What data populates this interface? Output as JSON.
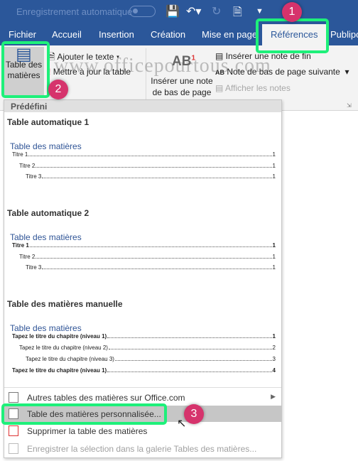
{
  "titlebar": {
    "autosave_label": "Enregistrement automatique"
  },
  "tabs": [
    {
      "label": "Fichier"
    },
    {
      "label": "Accueil"
    },
    {
      "label": "Insertion"
    },
    {
      "label": "Création"
    },
    {
      "label": "Mise en page"
    },
    {
      "label": "Références",
      "active": true
    },
    {
      "label": "Publipo"
    }
  ],
  "ribbon": {
    "toc_button": "Table des matières",
    "add_text": "Ajouter le texte",
    "update_table": "Mettre à jour la table",
    "insert_footnote": "Insérer une note de bas de page",
    "ab_label": "AB",
    "ab_sup": "1",
    "insert_endnote": "Insérer une note de fin",
    "next_footnote": "Note de bas de page suivante",
    "show_notes": "Afficher les notes",
    "watermark": "www.officepourtous.com"
  },
  "menu": {
    "header": "Prédéfini",
    "sections": [
      {
        "title": "Table automatique 1",
        "preview_title": "Table des matières",
        "rows": [
          {
            "text": "Titre 1",
            "page": "1"
          },
          {
            "text": "Titre 2",
            "page": "1"
          },
          {
            "text": "Titre 3",
            "page": "1"
          }
        ]
      },
      {
        "title": "Table automatique 2",
        "preview_title": "Table des matières",
        "rows": [
          {
            "text": "Titre 1",
            "page": "1"
          },
          {
            "text": "Titre 2",
            "page": "1"
          },
          {
            "text": "Titre 3",
            "page": "1"
          }
        ]
      },
      {
        "title": "Table des matières manuelle",
        "preview_title": "Table des matières",
        "rows": [
          {
            "text": "Tapez le titre du chapitre (niveau 1)",
            "page": "1"
          },
          {
            "text": "Tapez le titre du chapitre (niveau 2)",
            "page": "2"
          },
          {
            "text": "Tapez le titre du chapitre (niveau 3)",
            "page": "3"
          },
          {
            "text": "Tapez le titre du chapitre (niveau 1)",
            "page": "4"
          },
          {
            "text": "Tapez le titre du chapitre (niveau 2)",
            "page": "5"
          }
        ]
      }
    ],
    "items": [
      {
        "label": "Autres tables des matières sur Office.com"
      },
      {
        "label": "Table des matières personnalisée..."
      },
      {
        "label": "Supprimer la table des matières"
      },
      {
        "label": "Enregistrer la sélection dans la galerie Tables des matières..."
      }
    ]
  },
  "badges": [
    "1",
    "2",
    "3"
  ],
  "colors": {
    "ribbon_blue": "#2b579a",
    "highlight_green": "#1ef07a",
    "badge": "#d6336c"
  }
}
